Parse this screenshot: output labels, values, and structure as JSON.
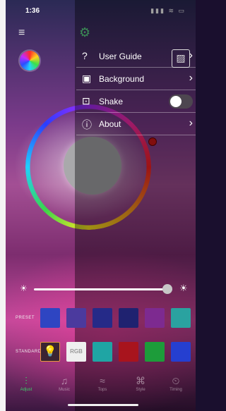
{
  "status_bar": {
    "time": "1:36",
    "indicators": "▮▮▮ ≋ ▭"
  },
  "nav": {
    "menu_icon": "≡",
    "gear_icon": "⚙"
  },
  "color_wheel_button": {
    "icon": "color-wheel-icon"
  },
  "side_menu": {
    "items": [
      {
        "label": "User Guide",
        "icon": "?",
        "chevron": "›"
      },
      {
        "label": "Background",
        "icon": "▣",
        "chevron": "›"
      },
      {
        "label": "Shake",
        "icon": "⊡",
        "toggle_on": false
      },
      {
        "label": "About",
        "icon": "ⓘ",
        "chevron": "›"
      }
    ],
    "image_icon": "▨"
  },
  "brightness": {
    "left_icon": "☀",
    "right_icon": "☀",
    "level": 0.92
  },
  "preset": {
    "label": "PRESET",
    "colors": [
      "#2e45c2",
      "#4b3a9e",
      "#252a88",
      "#1f2270",
      "#7d2a90",
      "#2aa2a0"
    ]
  },
  "standard": {
    "label": "STANDARD",
    "bulb_icon": "💡",
    "rgb_label": "RGB",
    "colors": [
      "#1fa5a4",
      "#a8141d",
      "#1d9c3a",
      "#253fd0"
    ]
  },
  "tabbar": {
    "tabs": [
      {
        "label": "Adjust",
        "icon": "⫶",
        "active": true
      },
      {
        "label": "Music",
        "icon": "♫",
        "active": false
      },
      {
        "label": "Tops",
        "icon": "≈",
        "active": false
      },
      {
        "label": "Style",
        "icon": "⌘",
        "active": false
      },
      {
        "label": "Timing",
        "icon": "⏲",
        "active": false
      }
    ]
  },
  "colors": {
    "accent": "#3bd66a",
    "ring_knob": "#d01818"
  }
}
